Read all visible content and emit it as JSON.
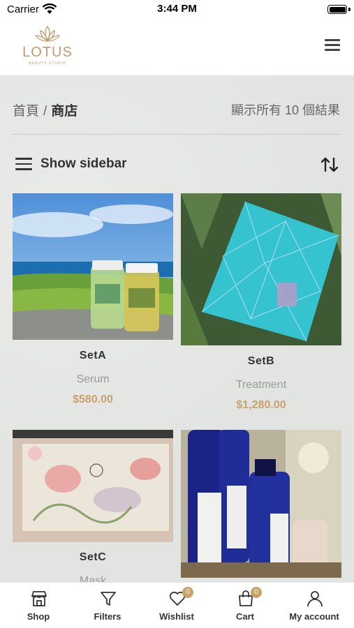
{
  "status_bar": {
    "carrier": "Carrier",
    "time": "3:44 PM"
  },
  "header": {
    "logo_text": "LOTUS",
    "logo_subtext": "BEAUTY STUDIO"
  },
  "breadcrumb": {
    "home": "首頁",
    "separator": "/",
    "current": "商店"
  },
  "result_count": "顯示所有 10 個結果",
  "toolbar": {
    "sidebar_label": "Show sidebar"
  },
  "products": [
    {
      "name": "SetA",
      "category": "Serum",
      "price": "$580.00"
    },
    {
      "name": "SetB",
      "category": "Treatment",
      "price": "$1,280.00"
    },
    {
      "name": "SetC",
      "category": "Mask"
    },
    {
      "name": "",
      "category": ""
    }
  ],
  "tab_bar": {
    "tabs": [
      {
        "label": "Shop",
        "icon": "shop-icon"
      },
      {
        "label": "Filters",
        "icon": "filter-icon"
      },
      {
        "label": "Wishlist",
        "icon": "heart-icon",
        "badge": "0"
      },
      {
        "label": "Cart",
        "icon": "cart-icon",
        "badge": "0"
      },
      {
        "label": "My account",
        "icon": "user-icon"
      }
    ]
  },
  "colors": {
    "accent": "#c8a16b",
    "logo": "#c19a6b",
    "background": "#e4e6e4"
  }
}
